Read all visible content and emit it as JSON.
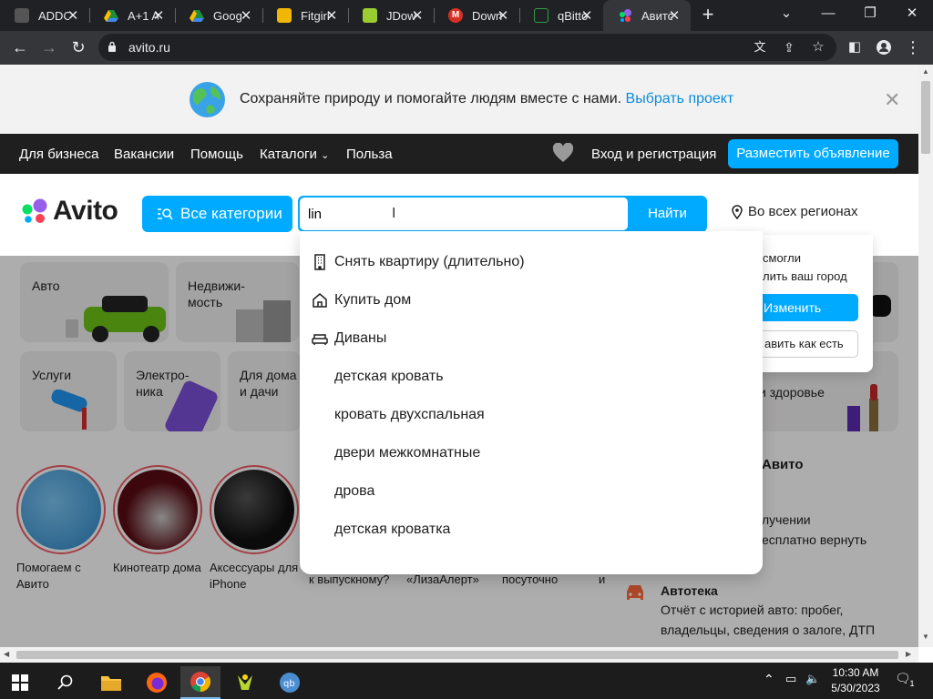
{
  "browser": {
    "tabs": [
      {
        "title": "ADDO",
        "color": "#444444"
      },
      {
        "title": "A+1 A",
        "color": "#1e8e3e"
      },
      {
        "title": "Goog",
        "color": "#fbbc04"
      },
      {
        "title": "Fitgirl",
        "color": "#f2b705"
      },
      {
        "title": "JDow",
        "color": "#9acd32"
      },
      {
        "title": "Down",
        "color": "#d93025"
      },
      {
        "title": "qBitto",
        "color": "#2f9e44"
      },
      {
        "title": "Авито",
        "color": "#04e061"
      }
    ],
    "url": "avito.ru"
  },
  "banner": {
    "text": "Сохраняйте природу и помогайте людям вместе с нами.",
    "link": "Выбрать проект"
  },
  "nav": {
    "items": [
      "Для бизнеса",
      "Вакансии",
      "Помощь",
      "Каталоги",
      "Польза"
    ],
    "login": "Вход и регистрация",
    "post_ad": "Разместить объявление"
  },
  "header": {
    "logo": "Avito",
    "all_categories": "Все категории",
    "search_value": "lin",
    "find": "Найти",
    "region": "Во всех регионах"
  },
  "suggestions": [
    {
      "text": "Снять квартиру (длительно)",
      "icon": "building-icon"
    },
    {
      "text": "Купить дом",
      "icon": "house-icon"
    },
    {
      "text": "Диваны",
      "icon": "sofa-icon"
    },
    {
      "text": "детская кровать",
      "icon": ""
    },
    {
      "text": "кровать двухспальная",
      "icon": ""
    },
    {
      "text": "двери межкомнатные",
      "icon": ""
    },
    {
      "text": "дрова",
      "icon": ""
    },
    {
      "text": "детская кроватка",
      "icon": ""
    }
  ],
  "location_popup": {
    "text_line1": "смогли",
    "text_line2": "лить ваш город",
    "change": "Изменить",
    "leave": "авить как есть"
  },
  "categories": [
    "Авто",
    "Недвижи-мость",
    "Услуги",
    "Электро-ника",
    "Для дома и дачи",
    "и здоровье"
  ],
  "stories": [
    {
      "caption": "Помогаем с Авито"
    },
    {
      "caption": "Кинотеатр дома"
    },
    {
      "caption": "Аксессуары для iPhone"
    },
    {
      "caption": "к выпускному?"
    },
    {
      "caption": "«ЛизаАлерт»"
    },
    {
      "caption": "посуточно"
    }
  ],
  "side": {
    "title": "Авито",
    "line1": "лучении",
    "line2": "есплатно вернуть",
    "autoteka_title": "Автотека",
    "autoteka_line1": "Отчёт с историей авто: пробег,",
    "autoteka_line2": "владельцы, сведения о залоге, ДТП"
  },
  "taskbar": {
    "time": "10:30 AM",
    "date": "5/30/2023",
    "notifications": "1"
  }
}
